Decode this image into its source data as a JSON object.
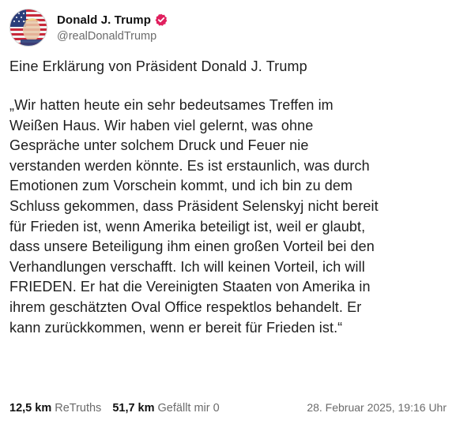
{
  "author": {
    "display_name": "Donald J. Trump",
    "handle": "@realDonaldTrump",
    "verified_icon": "verified-badge-icon",
    "verified_color": "#e0205e"
  },
  "post": {
    "title": "Eine Erklärung von Präsident Donald J. Trump",
    "lines": [
      "„Wir hatten heute ein sehr bedeutsames Treffen im",
      "Weißen Haus. Wir haben viel gelernt, was ohne",
      "Gespräche unter solchem Druck und Feuer nie",
      "verstanden werden könnte. Es ist erstaunlich, was durch",
      "Emotionen zum Vorschein kommt, und ich bin zu dem",
      "Schluss gekommen, dass Präsident Selenskyj nicht bereit",
      "für Frieden ist, wenn Amerika beteiligt ist, weil er glaubt,",
      "dass unsere Beteiligung ihm einen großen Vorteil bei den",
      "Verhandlungen verschafft. Ich will keinen Vorteil, ich will",
      "FRIEDEN. Er hat die Vereinigten Staaten von Amerika in",
      "ihrem geschätzten Oval Office respektlos behandelt. Er",
      "kann zurückkommen, wenn er bereit für Frieden ist.“"
    ]
  },
  "stats": {
    "retruths_count": "12,5 km",
    "retruths_label": "ReTruths",
    "likes_count": "51,7 km",
    "likes_label": "Gefällt mir 0"
  },
  "timestamp": "28. Februar 2025, 19:16 Uhr"
}
